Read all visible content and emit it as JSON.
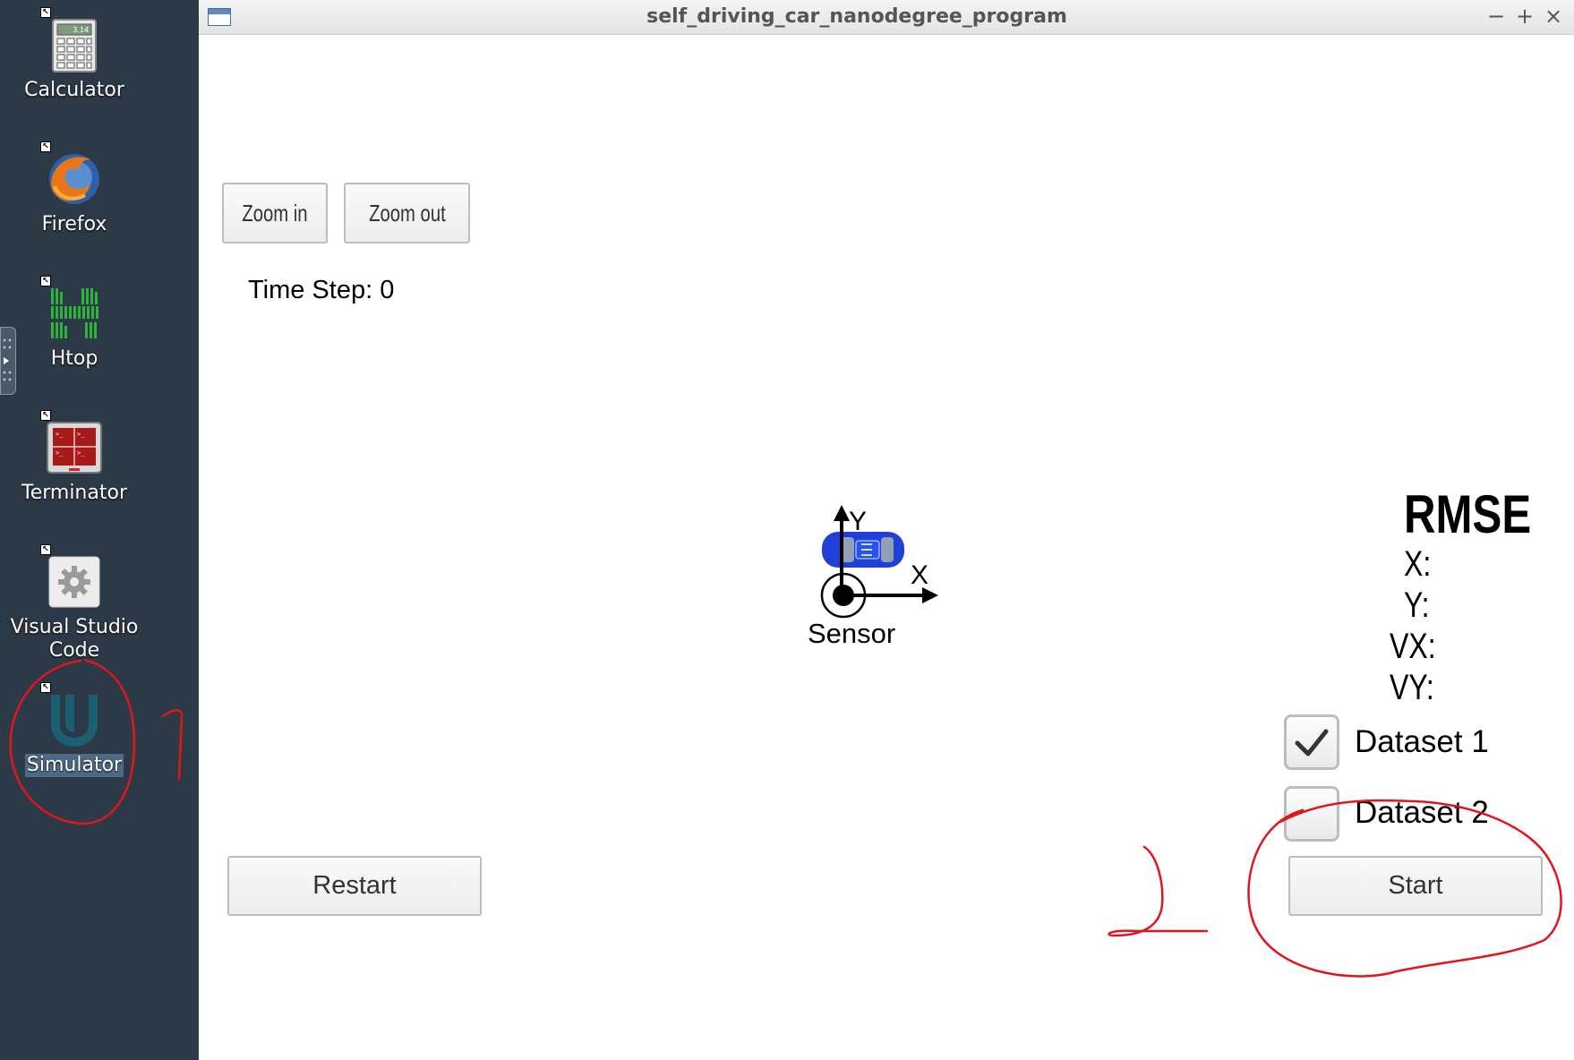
{
  "desktop": {
    "icons": [
      {
        "label": "Calculator",
        "badge": "3.14",
        "icon": "calculator-icon"
      },
      {
        "label": "Firefox",
        "icon": "firefox-icon"
      },
      {
        "label": "Htop",
        "icon": "htop-icon"
      },
      {
        "label": "Terminator",
        "icon": "terminator-icon"
      },
      {
        "label": "Visual Studio Code",
        "icon": "gear-icon"
      },
      {
        "label": "Simulator",
        "icon": "udacity-u-icon",
        "selected": true
      }
    ]
  },
  "window": {
    "title": "self_driving_car_nanodegree_program",
    "controls": {
      "minimize": "−",
      "maximize": "+",
      "close": "×"
    }
  },
  "toolbar": {
    "zoom_in": "Zoom in",
    "zoom_out": "Zoom out"
  },
  "time_step": "Time Step: 0",
  "scene": {
    "axis_y": "Y",
    "axis_x": "X",
    "sensor_label": "Sensor"
  },
  "rmse": {
    "title": "RMSE",
    "x": "X:",
    "y": "Y:",
    "vx": "VX:",
    "vy": "VY:"
  },
  "datasets": [
    {
      "label": "Dataset 1",
      "checked": true
    },
    {
      "label": "Dataset 2",
      "checked": false
    }
  ],
  "buttons": {
    "restart": "Restart",
    "start": "Start"
  },
  "annotations": {
    "mark_1": "1",
    "mark_2": "2",
    "color": "#e0161c"
  },
  "colors": {
    "desktop_bg": "#2c3946",
    "car": "#1f3fd6",
    "selected_label_bg": "#4d6b86"
  }
}
